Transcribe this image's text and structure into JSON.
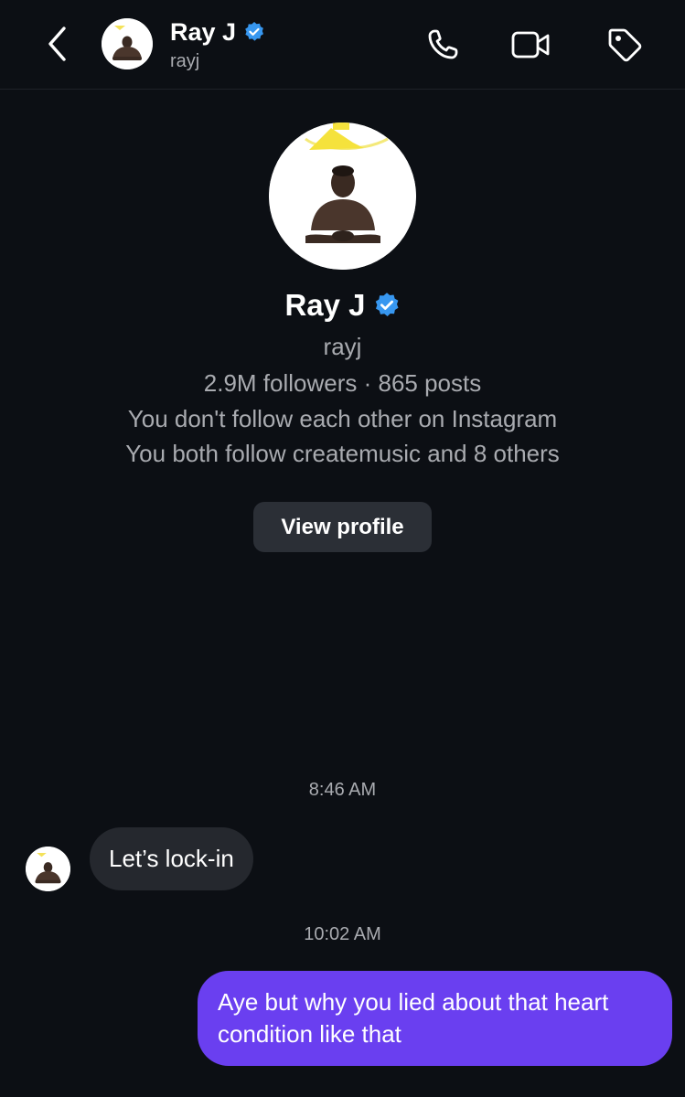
{
  "header": {
    "back_icon": "chevron-left-icon",
    "name": "Ray J",
    "username": "rayj",
    "verified_color": "#3797f0",
    "icons": [
      "phone-icon",
      "video-camera-icon",
      "tag-icon"
    ]
  },
  "profile": {
    "name": "Ray J",
    "username": "rayj",
    "stats": "2.9M followers · 865 posts",
    "follow_status": "You don't follow each other on Instagram",
    "mutual": "You both follow createmusic and 8 others",
    "view_profile_label": "View profile"
  },
  "messages": {
    "timestamp_1": "8:46 AM",
    "incoming_text": "Let’s lock-in",
    "timestamp_2": "10:02 AM",
    "outgoing_line_1": "Aye but why you lied about that heart",
    "outgoing_line_2": "condition like that",
    "outgoing_color": "#6a3ff0"
  }
}
